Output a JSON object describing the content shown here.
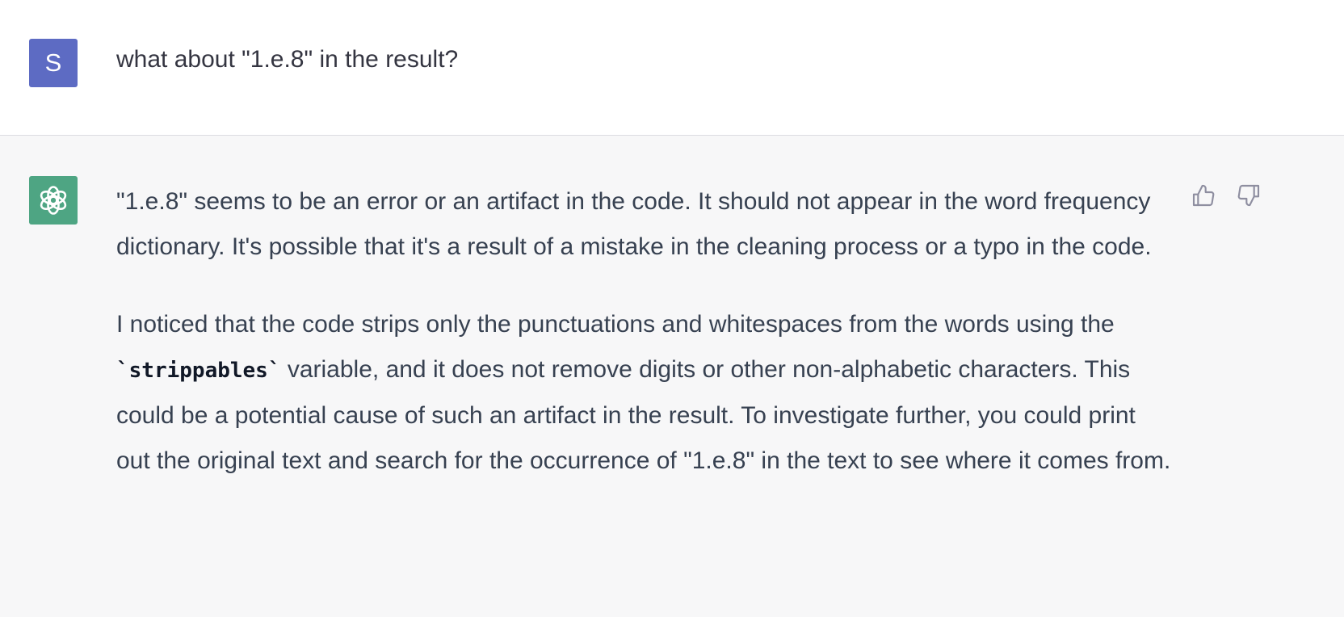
{
  "user_message": {
    "avatar_letter": "S",
    "text": "what about \"1.e.8\" in the result?"
  },
  "assistant_message": {
    "paragraph1": "\"1.e.8\" seems to be an error or an artifact in the code. It should not appear in the word frequency dictionary. It's possible that it's a result of a mistake in the cleaning process or a typo in the code.",
    "paragraph2_part1": "I noticed that the code strips only the punctuations and whitespaces from the words using the ",
    "paragraph2_code": "`strippables`",
    "paragraph2_part2": " variable, and it does not remove digits or other non-alphabetic characters. This could be a potential cause of such an artifact in the result. To investigate further, you could print out the original text and search for the occurrence of \"1.e.8\" in the text to see where it comes from."
  },
  "icons": {
    "assistant_avatar": "openai-logo-icon",
    "thumbs_up": "thumbs-up-icon",
    "thumbs_down": "thumbs-down-icon"
  },
  "colors": {
    "user_avatar_bg": "#5d6bc3",
    "assistant_avatar_bg": "#4ea583",
    "user_row_bg": "#ffffff",
    "assistant_row_bg": "#f7f7f8",
    "text": "#374151"
  }
}
